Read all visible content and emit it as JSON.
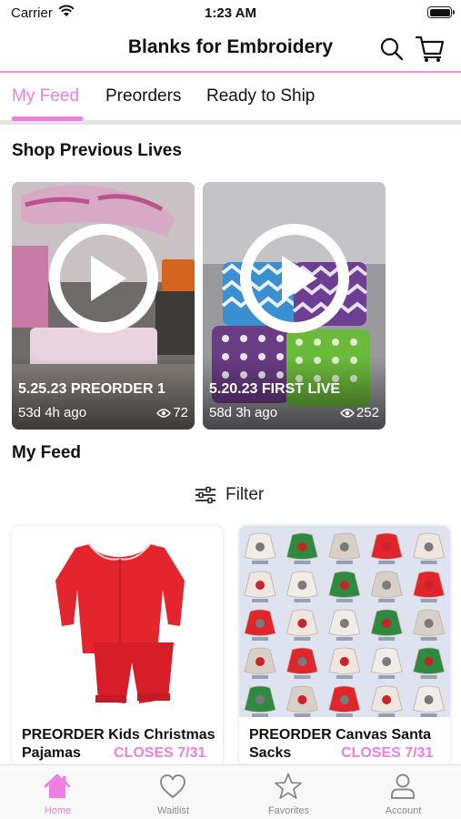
{
  "status_bar": {
    "carrier": "Carrier",
    "time": "1:23 AM"
  },
  "header": {
    "title": "Blanks for Embroidery"
  },
  "tabs": [
    {
      "label": "My Feed",
      "active": true
    },
    {
      "label": "Preorders",
      "active": false
    },
    {
      "label": "Ready to Ship",
      "active": false
    }
  ],
  "lives_section": {
    "title": "Shop Previous Lives",
    "items": [
      {
        "name": "5.25.23 PREORDER 1",
        "ago": "53d 4h ago",
        "views": "72"
      },
      {
        "name": "5.20.23 FIRST LIVE",
        "ago": "58d 3h ago",
        "views": "252"
      }
    ]
  },
  "feed_section": {
    "title": "My Feed",
    "filter_label": "Filter"
  },
  "products": [
    {
      "name": "PREORDER Kids Christmas Pajamas",
      "badge": "CLOSES 7/31"
    },
    {
      "name": "PREORDER Canvas Santa Sacks",
      "badge": "CLOSES 7/31"
    }
  ],
  "bottom_nav": [
    {
      "label": "Home",
      "icon": "home-icon",
      "active": true
    },
    {
      "label": "Waitlist",
      "icon": "heart-icon",
      "active": false
    },
    {
      "label": "Favorites",
      "icon": "star-icon",
      "active": false
    },
    {
      "label": "Account",
      "icon": "person-icon",
      "active": false
    }
  ],
  "colors": {
    "accent": "#ee7fe0",
    "divider": "#e4e4e4"
  }
}
